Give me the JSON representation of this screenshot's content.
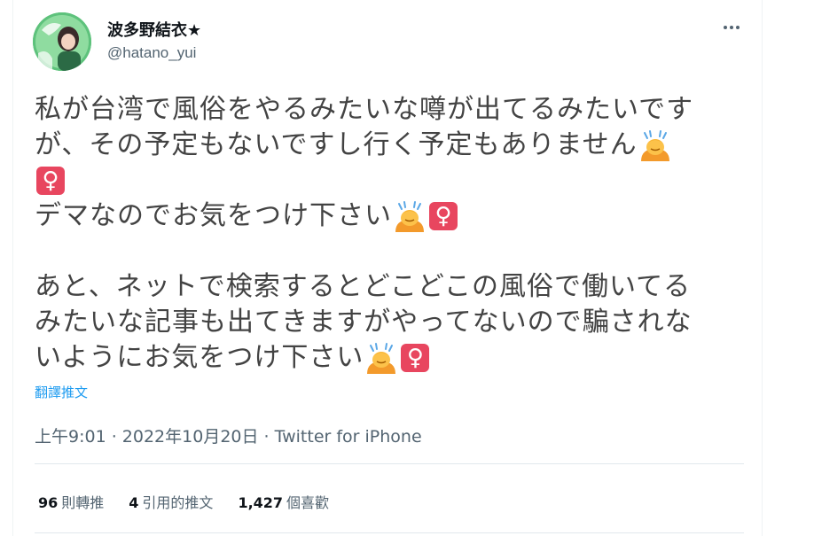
{
  "user": {
    "display_name": "波多野結衣★",
    "handle": "@hatano_yui"
  },
  "tweet": {
    "lines": [
      "私が台湾で風俗をやるみたいな噂が出てるみたいです",
      "が、その予定もないですし行く予定もありません",
      "",
      "デマなのでお気をつけ下さい",
      "あと、ネットで検索するとどこどこの風俗で働いてる",
      "みたいな記事も出てきますがやってないので騙されな",
      "いようにお気をつけ下さい"
    ],
    "female_sign": "♀",
    "translate_label": "翻譯推文"
  },
  "meta": {
    "time": "上午9:01",
    "separator": " · ",
    "date": "2022年10月20日",
    "source": "Twitter for iPhone"
  },
  "stats": {
    "retweets_count": "96",
    "retweets_label": "則轉推",
    "quotes_count": "4",
    "quotes_label": "引用的推文",
    "likes_count": "1,427",
    "likes_label": "個喜歡"
  },
  "colors": {
    "link": "#1d9bf0",
    "female_sign_bg": "#e8465f",
    "avatar_bg": "#5ec27c"
  },
  "icons": [
    "avatar",
    "more-icon",
    "person-bowing-emoji",
    "female-sign-emoji"
  ]
}
